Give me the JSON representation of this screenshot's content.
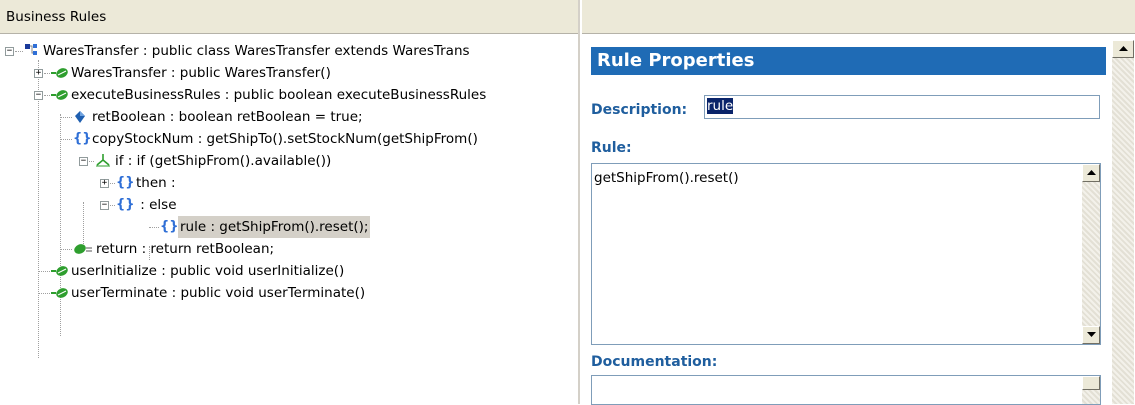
{
  "left_panel": {
    "title": "Business Rules"
  },
  "tree": {
    "root": "WaresTransfer : public class WaresTransfer extends WaresTrans",
    "constructor": "WaresTransfer : public  WaresTransfer()",
    "execute": "executeBusinessRules : public boolean executeBusinessRules",
    "retBoolean": "retBoolean : boolean retBoolean = true;",
    "copyStock": "copyStockNum : getShipTo().setStockNum(getShipFrom()",
    "if_node": "if : if (getShipFrom().available())",
    "then_node": "then :",
    "else_node": " : else",
    "rule_node": "rule : getShipFrom().reset();",
    "return_node": "return : return retBoolean;",
    "userInit": "userInitialize : public void userInitialize()",
    "userTerm": "userTerminate : public void userTerminate()"
  },
  "properties": {
    "title": "Rule Properties",
    "description_label": "Description:",
    "description_value": "rule",
    "rule_label": "Rule:",
    "rule_value": "getShipFrom().reset()",
    "documentation_label": "Documentation:"
  },
  "colors": {
    "title_bar": "#1f6bb5",
    "label": "#1f5e9e",
    "method_icon": "#2e9e2e",
    "expand_border": "#919b9c"
  },
  "icons": [
    "class-icon",
    "method-icon",
    "field-icon",
    "block-icon",
    "if-icon",
    "return-icon"
  ]
}
